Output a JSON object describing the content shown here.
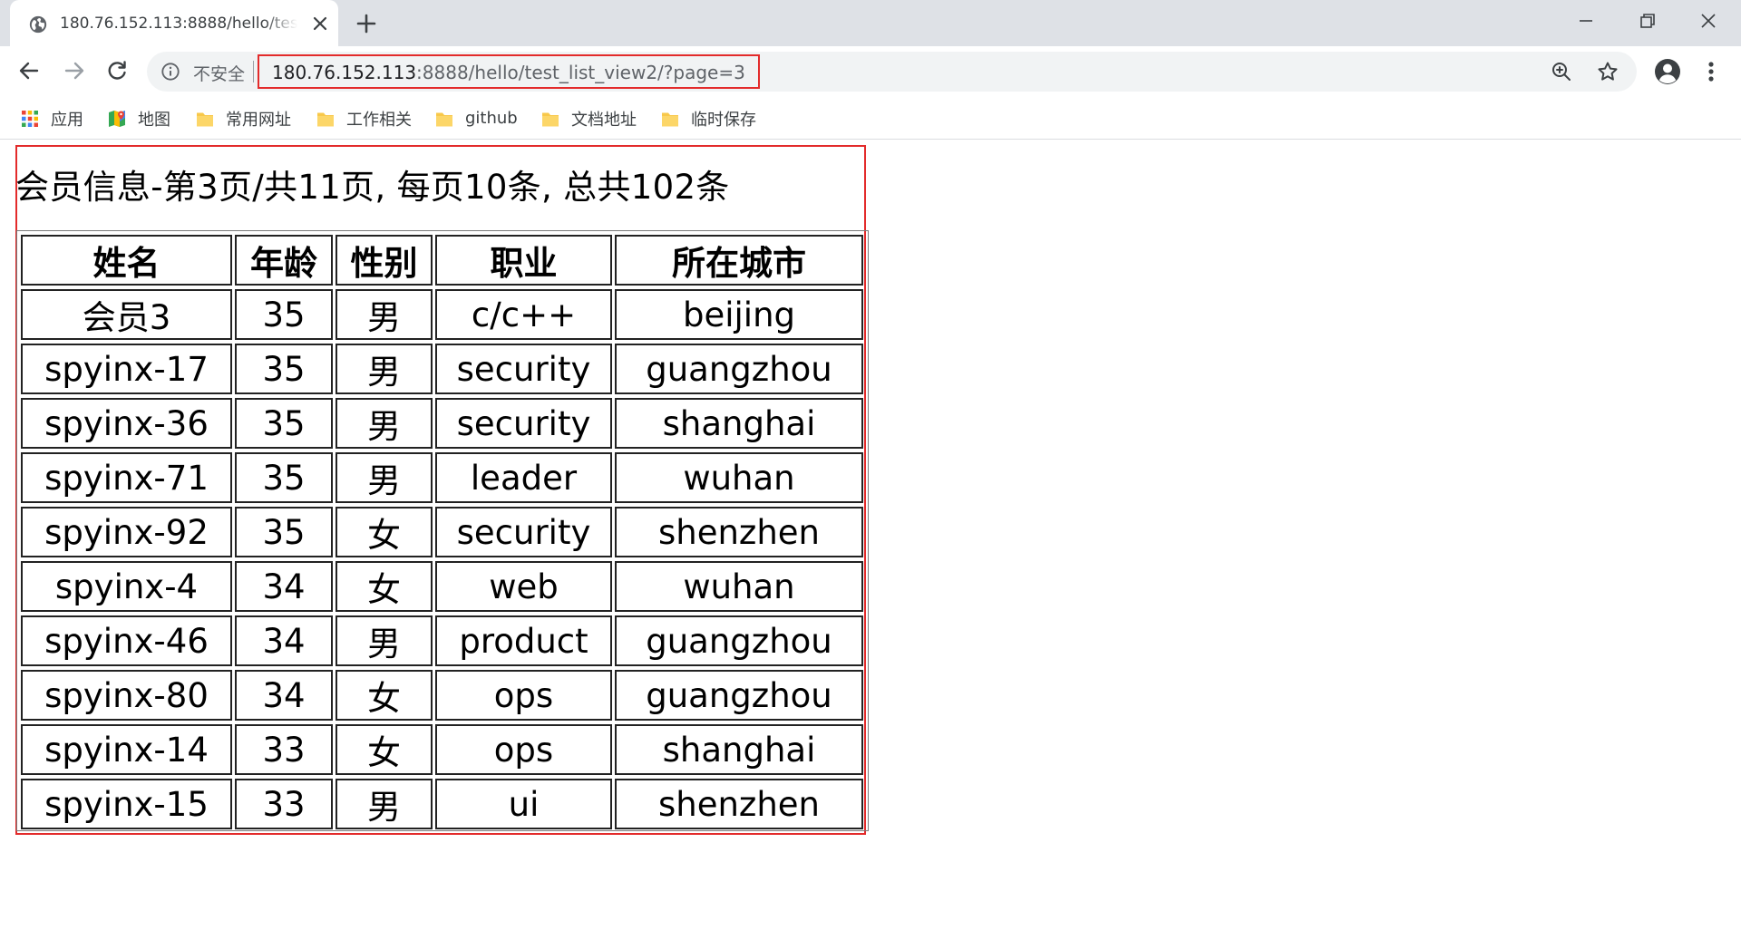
{
  "browser": {
    "tab_title": "180.76.152.113:8888/hello/test_list_view2/?page=3",
    "security_label": "不安全",
    "url_host": "180.76.152.113",
    "url_rest": ":8888/hello/test_list_view2/?page=3",
    "bookmarks": [
      {
        "label": "应用",
        "icon": "apps-grid-icon"
      },
      {
        "label": "地图",
        "icon": "maps-icon"
      },
      {
        "label": "常用网址",
        "icon": "folder-icon"
      },
      {
        "label": "工作相关",
        "icon": "folder-icon"
      },
      {
        "label": "github",
        "icon": "folder-icon"
      },
      {
        "label": "文档地址",
        "icon": "folder-icon"
      },
      {
        "label": "临时保存",
        "icon": "folder-icon"
      }
    ]
  },
  "page": {
    "title": "会员信息-第3页/共11页, 每页10条, 总共102条",
    "table": {
      "headers": [
        "姓名",
        "年龄",
        "性别",
        "职业",
        "所在城市"
      ],
      "rows": [
        [
          "会员3",
          "35",
          "男",
          "c/c++",
          "beijing"
        ],
        [
          "spyinx-17",
          "35",
          "男",
          "security",
          "guangzhou"
        ],
        [
          "spyinx-36",
          "35",
          "男",
          "security",
          "shanghai"
        ],
        [
          "spyinx-71",
          "35",
          "男",
          "leader",
          "wuhan"
        ],
        [
          "spyinx-92",
          "35",
          "女",
          "security",
          "shenzhen"
        ],
        [
          "spyinx-4",
          "34",
          "女",
          "web",
          "wuhan"
        ],
        [
          "spyinx-46",
          "34",
          "男",
          "product",
          "guangzhou"
        ],
        [
          "spyinx-80",
          "34",
          "女",
          "ops",
          "guangzhou"
        ],
        [
          "spyinx-14",
          "33",
          "女",
          "ops",
          "shanghai"
        ],
        [
          "spyinx-15",
          "33",
          "男",
          "ui",
          "shenzhen"
        ]
      ]
    }
  },
  "colors": {
    "highlight_border": "#e32b2b",
    "tabstrip_bg": "#dee1e6",
    "omnibox_bg": "#f1f3f4"
  }
}
